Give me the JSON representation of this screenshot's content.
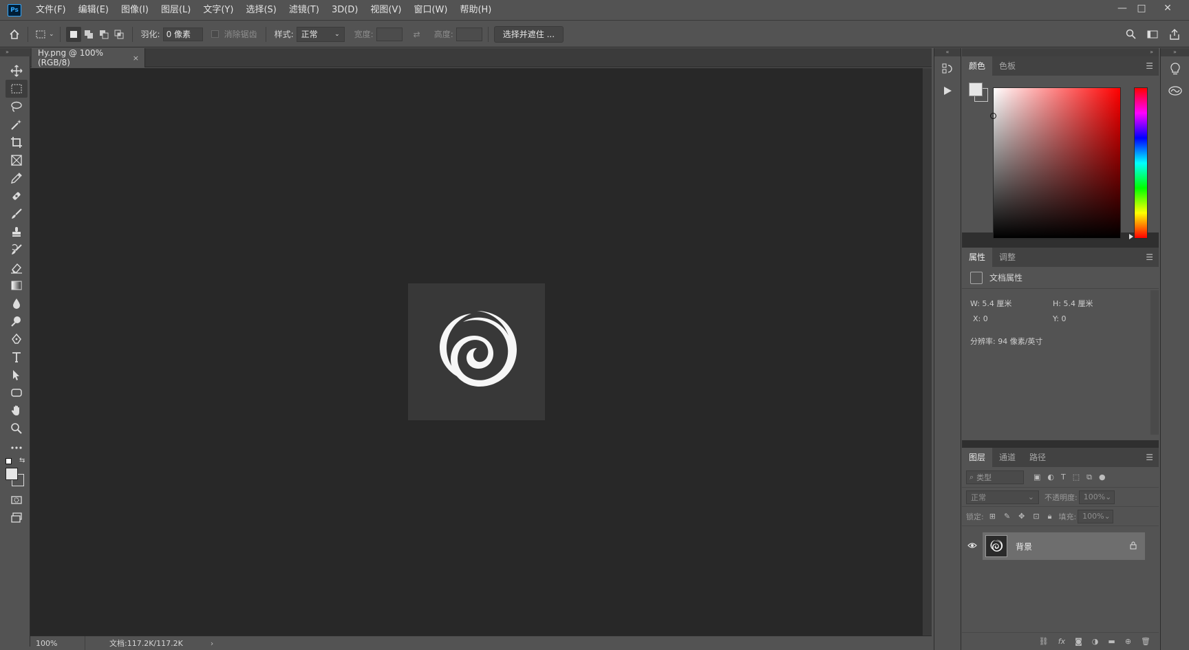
{
  "app": {
    "logo": "Ps",
    "menu": [
      "文件(F)",
      "编辑(E)",
      "图像(I)",
      "图层(L)",
      "文字(Y)",
      "选择(S)",
      "滤镜(T)",
      "3D(D)",
      "视图(V)",
      "窗口(W)",
      "帮助(H)"
    ]
  },
  "window_controls": {
    "minimize": "—",
    "maximize": "□",
    "close": "✕"
  },
  "options_bar": {
    "feather_label": "羽化:",
    "feather_value": "0 像素",
    "antialias_label": "消除锯齿",
    "style_label": "样式:",
    "style_value": "正常",
    "width_label": "宽度:",
    "height_label": "高度:",
    "select_mask_button": "选择并遮住 ..."
  },
  "document": {
    "tab_title": "Hy.png @ 100%(RGB/8)",
    "tab_close": "×"
  },
  "status": {
    "zoom": "100%",
    "doc_size": "文档:117.2K/117.2K",
    "arrow": "›"
  },
  "color_panel": {
    "tabs": [
      "颜色",
      "色板"
    ],
    "fg_color": "#e6e6e6",
    "bg_color": "#535353"
  },
  "properties_panel": {
    "tabs": [
      "属性",
      "调整"
    ],
    "section_title": "文档属性",
    "w": "W:  5.4 厘米",
    "h": "H:  5.4 厘米",
    "x": "X:  0",
    "y": "Y:  0",
    "resolution": "分辨率: 94 像素/英寸"
  },
  "layers_panel": {
    "tabs": [
      "图层",
      "通道",
      "路径"
    ],
    "search_placeholder": "类型",
    "blend_mode": "正常",
    "opacity_label": "不透明度:",
    "opacity_value": "100%",
    "lock_label": "锁定:",
    "fill_label": "填充:",
    "fill_value": "100%",
    "layers": [
      {
        "name": "背景",
        "visible": true,
        "locked": true
      }
    ]
  }
}
